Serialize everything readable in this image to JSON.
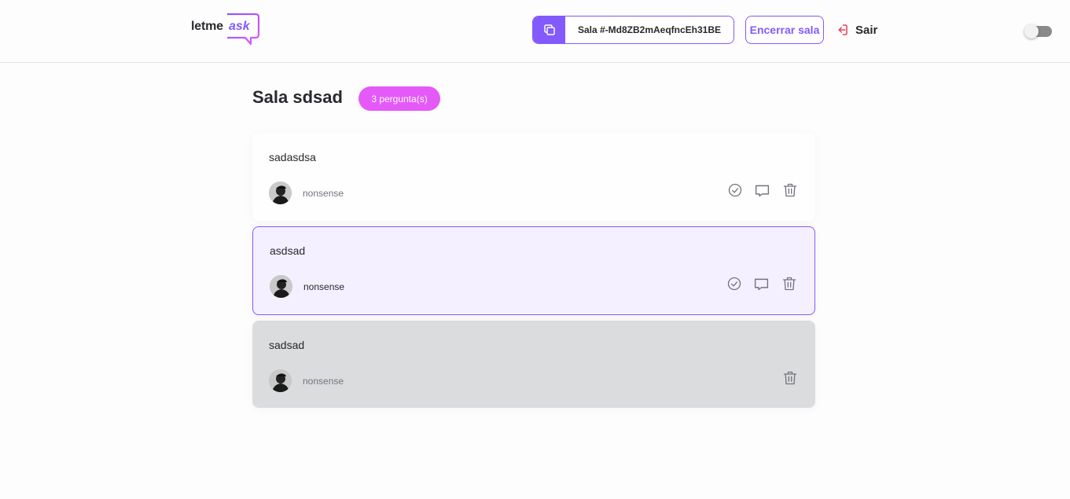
{
  "header": {
    "logo": {
      "part1": "letme",
      "part2": "ask"
    },
    "room_code_text": "Sala #-Md8ZB2mAeqfncEh31BE",
    "close_room_label": "Encerrar sala",
    "logout_label": "Sair"
  },
  "main": {
    "title": "Sala sdsad",
    "question_count": "3 pergunta(s)",
    "questions": [
      {
        "content": "sadasdsa",
        "author": "nonsense",
        "state": "default",
        "actions": [
          "check-icon",
          "answer-icon",
          "delete-icon"
        ]
      },
      {
        "content": "asdsad",
        "author": "nonsense",
        "state": "highlighted",
        "actions": [
          "check-icon",
          "answer-icon",
          "delete-icon"
        ]
      },
      {
        "content": "sadsad",
        "author": "nonsense",
        "state": "answered",
        "actions": [
          "delete-icon"
        ]
      }
    ]
  },
  "colors": {
    "accent": "#835afd",
    "badge": "#e559f9",
    "highlight_bg": "#f4f0ff",
    "answered_bg": "#dbdcdd",
    "logout_icon": "#e73f5d"
  }
}
